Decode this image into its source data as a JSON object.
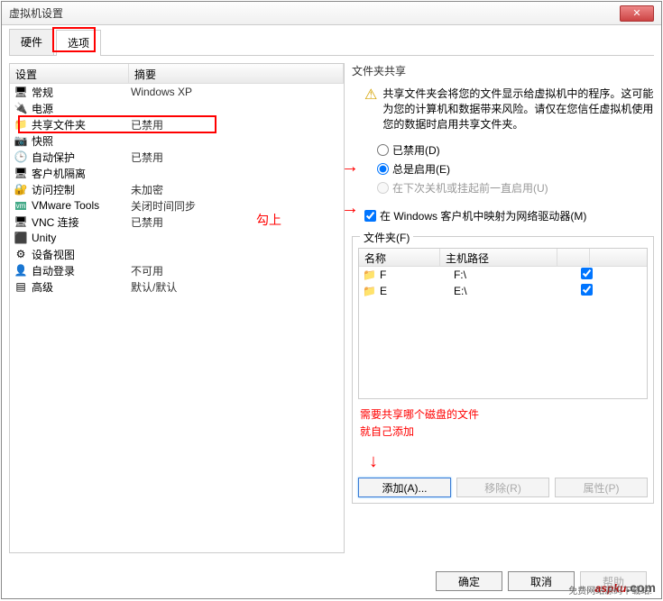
{
  "window": {
    "title": "虚拟机设置"
  },
  "tabs": {
    "hardware": "硬件",
    "options": "选项"
  },
  "list": {
    "head_setting": "设置",
    "head_summary": "摘要",
    "rows": [
      {
        "icon": "🖥",
        "name": "常规",
        "summary": "Windows XP"
      },
      {
        "icon": "🔌",
        "name": "电源",
        "summary": ""
      },
      {
        "icon": "📁",
        "name": "共享文件夹",
        "summary": "已禁用"
      },
      {
        "icon": "📷",
        "name": "快照",
        "summary": ""
      },
      {
        "icon": "🕒",
        "name": "自动保护",
        "summary": "已禁用"
      },
      {
        "icon": "🖥",
        "name": "客户机隔离",
        "summary": ""
      },
      {
        "icon": "🔐",
        "name": "访问控制",
        "summary": "未加密"
      },
      {
        "icon": "vm",
        "name": "VMware Tools",
        "summary": "关闭时间同步"
      },
      {
        "icon": "🖥",
        "name": "VNC 连接",
        "summary": "已禁用"
      },
      {
        "icon": "⬛",
        "name": "Unity",
        "summary": ""
      },
      {
        "icon": "⚙",
        "name": "设备视图",
        "summary": ""
      },
      {
        "icon": "👤",
        "name": "自动登录",
        "summary": "不可用"
      },
      {
        "icon": "▤",
        "name": "高级",
        "summary": "默认/默认"
      }
    ]
  },
  "share": {
    "title": "文件夹共享",
    "warning": "共享文件夹会将您的文件显示给虚拟机中的程序。这可能为您的计算机和数据带来风险。请仅在您信任虚拟机使用您的数据时启用共享文件夹。",
    "opt_disabled": "已禁用(D)",
    "opt_always": "总是启用(E)",
    "opt_until": "在下次关机或挂起前一直启用(U)",
    "chk_map": "在 Windows 客户机中映射为网络驱动器(M)"
  },
  "folders": {
    "legend": "文件夹(F)",
    "head_name": "名称",
    "head_path": "主机路径",
    "rows": [
      {
        "name": "F",
        "path": "F:\\",
        "checked": true
      },
      {
        "name": "E",
        "path": "E:\\",
        "checked": true
      }
    ],
    "btn_add": "添加(A)...",
    "btn_remove": "移除(R)",
    "btn_prop": "属性(P)"
  },
  "annot": {
    "check": "勾上",
    "folders_l1": "需要共享哪个磁盘的文件",
    "folders_l2": "就自己添加"
  },
  "bottom": {
    "ok": "确定",
    "cancel": "取消",
    "help": "帮助"
  },
  "watermark": {
    "brand": "aspku",
    "dom": ".com",
    "sub": "免费网站源码下载站!"
  }
}
